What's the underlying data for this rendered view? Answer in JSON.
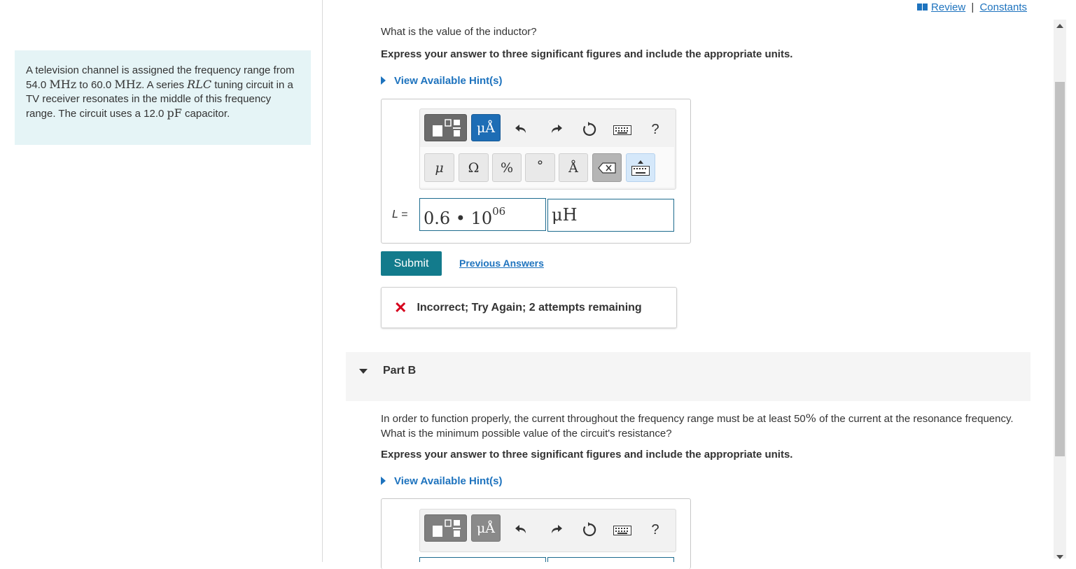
{
  "header": {
    "review_label": "Review",
    "separator": "|",
    "constants_label": "Constants"
  },
  "problem": {
    "text_1": "A television channel is assigned the frequency range from 54.0 ",
    "unit_mhz_1": "MHz",
    "text_2": " to 60.0 ",
    "unit_mhz_2": "MHz",
    "text_3": ". A series ",
    "rlc": "RLC",
    "text_4": " tuning circuit in a TV receiver resonates in the middle of this frequency range. The circuit uses a 12.0 ",
    "unit_pf": "pF",
    "text_5": " capacitor."
  },
  "part_a": {
    "question": "What is the value of the inductor?",
    "instruction": "Express your answer to three significant figures and include the appropriate units.",
    "hint_label": "View Available Hint(s)",
    "toolbar": {
      "units_label": "μÅ",
      "help_label": "?",
      "symbols": [
        "μ",
        "Ω",
        "%",
        "°",
        "Å"
      ]
    },
    "variable_label": "L =",
    "value_main": "0.6 • 10",
    "value_exp": "06",
    "unit_value": "μH",
    "submit_label": "Submit",
    "previous_answers_label": "Previous Answers",
    "feedback_icon": "✕",
    "feedback_text": "Incorrect; Try Again; 2 attempts remaining"
  },
  "part_b": {
    "label": "Part B",
    "question_1": "In order to function properly, the current throughout the frequency range must be at least 50",
    "percent": "%",
    "question_2": " of the current at the resonance frequency. What is the minimum possible value of the circuit's resistance?",
    "instruction": "Express your answer to three significant figures and include the appropriate units.",
    "hint_label": "View Available Hint(s)",
    "toolbar": {
      "units_label": "μÅ",
      "help_label": "?"
    }
  },
  "colors": {
    "accent": "#1e73be",
    "submit": "#137b8c",
    "panel": "#e5f4f6",
    "error": "#d6001c"
  }
}
